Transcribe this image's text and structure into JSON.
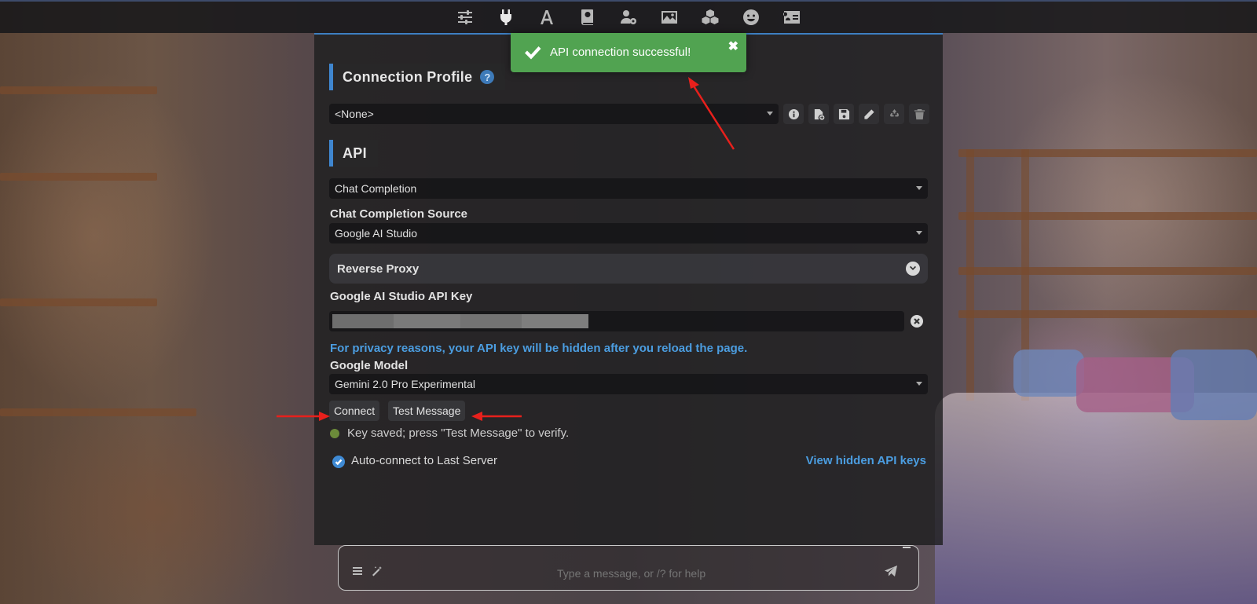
{
  "nav": {
    "icons": [
      "sliders-icon",
      "plug-icon",
      "font-icon",
      "book-icon",
      "user-gear-icon",
      "image-icon",
      "cubes-icon",
      "smile-icon",
      "id-card-icon"
    ],
    "active": "plug-icon"
  },
  "toast": {
    "message": "API connection successful!",
    "close_glyph": "✖"
  },
  "connection_profile": {
    "title": "Connection Profile",
    "help_glyph": "?",
    "selected": "<None>",
    "toolbar": [
      "info-icon",
      "file-add-icon",
      "save-icon",
      "pencil-icon",
      "recycle-icon",
      "trash-icon"
    ]
  },
  "api": {
    "title": "API",
    "type_selected": "Chat Completion",
    "source_label": "Chat Completion Source",
    "source_selected": "Google AI Studio",
    "reverse_proxy_label": "Reverse Proxy",
    "key_label": "Google AI Studio API Key",
    "privacy_note": "For privacy reasons, your API key will be hidden after you reload the page.",
    "model_label": "Google Model",
    "model_selected": "Gemini 2.0 Pro Experimental",
    "connect_label": "Connect",
    "test_label": "Test Message",
    "status_text": "Key saved; press \"Test Message\" to verify.",
    "autoconnect_label": "Auto-connect to Last Server",
    "autoconnect_checked": true,
    "view_keys_label": "View hidden API keys"
  },
  "chat": {
    "placeholder": "Type a message, or /? for help"
  },
  "colors": {
    "accent": "#3f86cf",
    "toast": "#51a351",
    "link": "#4b9de0",
    "status_ok": "#6c8b3a",
    "annotation_arrow": "#e8201c"
  }
}
